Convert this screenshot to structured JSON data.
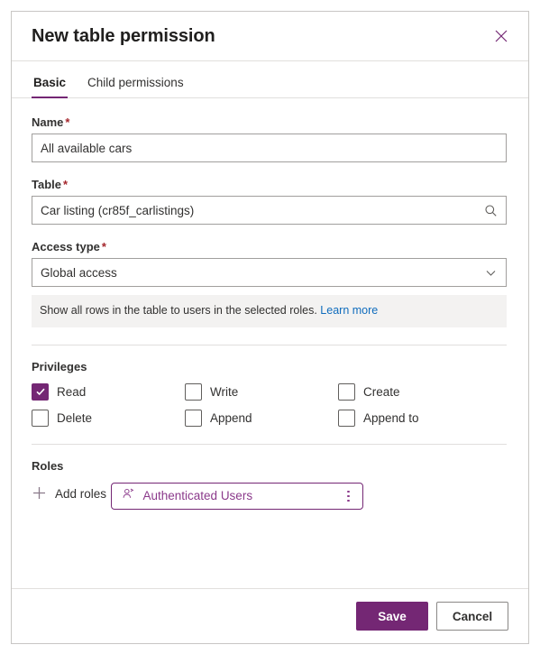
{
  "panel": {
    "title": "New table permission",
    "close_icon": "close-icon"
  },
  "tabs": [
    {
      "label": "Basic",
      "active": true
    },
    {
      "label": "Child permissions",
      "active": false
    }
  ],
  "fields": {
    "name": {
      "label": "Name",
      "required_mark": "*",
      "value": "All available cars",
      "placeholder": ""
    },
    "table": {
      "label": "Table",
      "required_mark": "*",
      "value": "Car listing (cr85f_carlistings)",
      "placeholder": "",
      "icon": "search-icon"
    },
    "access_type": {
      "label": "Access type",
      "required_mark": "*",
      "value": "Global access",
      "placeholder": "",
      "icon": "chevron-down-icon",
      "options": [
        "Global access"
      ],
      "hint_text": "Show all rows in the table to users in the selected roles.",
      "hint_link": "Learn more"
    }
  },
  "privileges": {
    "title": "Privileges",
    "items": [
      {
        "label": "Read",
        "checked": true
      },
      {
        "label": "Write",
        "checked": false
      },
      {
        "label": "Create",
        "checked": false
      },
      {
        "label": "Delete",
        "checked": false
      },
      {
        "label": "Append",
        "checked": false
      },
      {
        "label": "Append to",
        "checked": false
      }
    ]
  },
  "roles": {
    "title": "Roles",
    "add_label": "Add roles",
    "add_icon": "plus-icon",
    "chips": [
      {
        "label": "Authenticated Users",
        "icon": "person-icon",
        "menu_icon": "more-vertical-icon"
      }
    ]
  },
  "footer": {
    "save_label": "Save",
    "cancel_label": "Cancel"
  },
  "colors": {
    "accent": "#742774",
    "required": "#a4262c",
    "link": "#0f6cbd",
    "info_bg": "#f3f2f1",
    "border": "#a19f9d"
  }
}
